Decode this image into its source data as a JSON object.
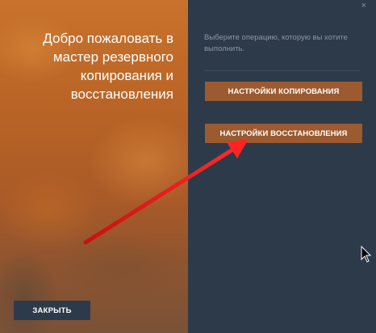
{
  "left": {
    "title": "Добро пожаловать в мастер резервного копирования и восстановления",
    "close_label": "ЗАКРЫТЬ"
  },
  "right": {
    "prompt": "Выберите операцию, которую вы хотите выполнить.",
    "backup_label": "НАСТРОЙКИ КОПИРОВАНИЯ",
    "restore_label": "НАСТРОЙКИ ВОССТАНОВЛЕНИЯ"
  },
  "window": {
    "close_glyph": "×"
  },
  "colors": {
    "panel_bg": "#2d3a4a",
    "accent_button": "#9b5a2f",
    "annotation_arrow": "#e8201f"
  },
  "icons": [
    "close-icon",
    "mouse-cursor-icon",
    "annotation-arrow"
  ]
}
